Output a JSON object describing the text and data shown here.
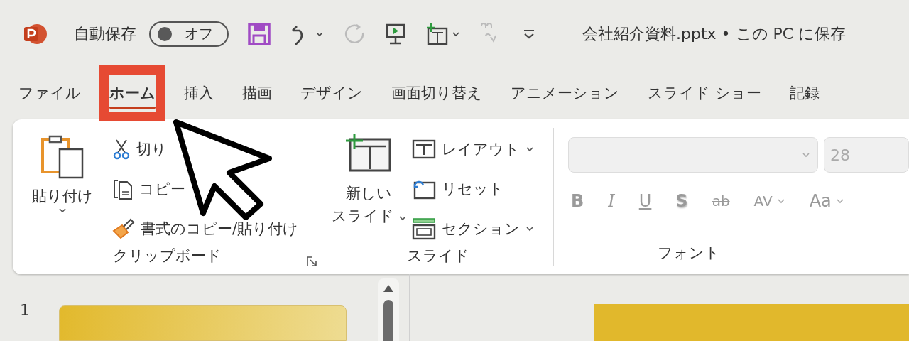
{
  "title_bar": {
    "autosave_label": "自動保存",
    "autosave_toggle": {
      "label": "オフ",
      "on": false
    },
    "quick_access": [
      {
        "kind": "save",
        "disabled": false
      },
      {
        "kind": "undo",
        "disabled": false
      },
      {
        "kind": "redo",
        "disabled": true
      },
      {
        "kind": "present",
        "disabled": false
      },
      {
        "kind": "new-slide",
        "disabled": false
      },
      {
        "kind": "spell",
        "disabled": true
      },
      {
        "kind": "customize",
        "disabled": false
      }
    ],
    "document_title": "会社紹介資料.pptx • この PC に保存"
  },
  "tabs": [
    {
      "label": "ファイル",
      "selected": false
    },
    {
      "label": "ホーム",
      "selected": true
    },
    {
      "label": "挿入",
      "selected": false
    },
    {
      "label": "描画",
      "selected": false
    },
    {
      "label": "デザイン",
      "selected": false
    },
    {
      "label": "画面切り替え",
      "selected": false
    },
    {
      "label": "アニメーション",
      "selected": false
    },
    {
      "label": "スライド ショー",
      "selected": false
    },
    {
      "label": "記録",
      "selected": false
    }
  ],
  "ribbon": {
    "clipboard": {
      "paste": "貼り付け",
      "cut": "切り",
      "copy": "コピー",
      "format_painter": "書式のコピー/貼り付け",
      "label": "クリップボード"
    },
    "slides": {
      "new_slide": [
        "新しい",
        "スライド"
      ],
      "layout": "レイアウト",
      "reset": "リセット",
      "section": "セクション",
      "label": "スライド"
    },
    "font": {
      "disabled": true,
      "size": "28",
      "buttons": [
        {
          "kind": "bold",
          "label": "B"
        },
        {
          "kind": "italic",
          "label": "I"
        },
        {
          "kind": "underline",
          "label": "U"
        },
        {
          "kind": "shadow",
          "label": "S"
        },
        {
          "kind": "strike",
          "label": "ab"
        },
        {
          "kind": "spacing",
          "label": "AV"
        },
        {
          "kind": "case",
          "label": "Aa"
        }
      ],
      "label": "フォント"
    }
  },
  "slide_pane": {
    "slide_number": "1"
  }
}
